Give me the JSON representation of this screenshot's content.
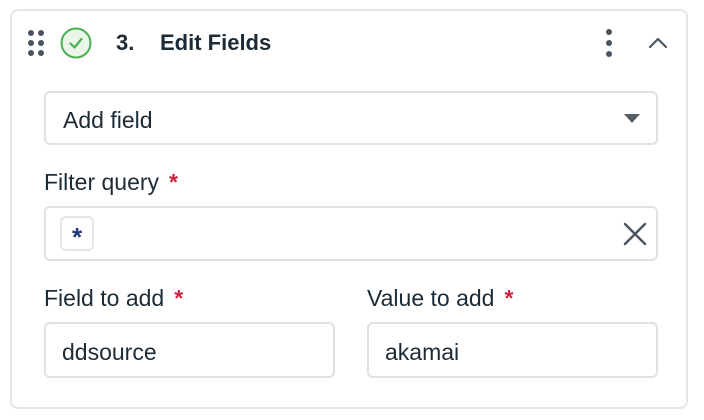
{
  "step": {
    "number": "3.",
    "title": "Edit Fields",
    "status": "complete"
  },
  "processor_select": {
    "value": "Add field"
  },
  "filter_query": {
    "label": "Filter query",
    "required_marker": "*",
    "token": "*"
  },
  "field_to_add": {
    "label": "Field to add",
    "required_marker": "*",
    "value": "ddsource"
  },
  "value_to_add": {
    "label": "Value to add",
    "required_marker": "*",
    "value": "akamai"
  },
  "icons": {
    "drag": "drag-handle-icon",
    "status": "check-circle-icon",
    "menu": "kebab-menu-icon",
    "collapse": "chevron-up-icon",
    "clear": "close-icon",
    "dropdown": "caret-down-icon"
  },
  "colors": {
    "success": "#4caf50",
    "required": "#c7263e",
    "token_text": "#1f3a7a",
    "border": "#dde2e8"
  }
}
